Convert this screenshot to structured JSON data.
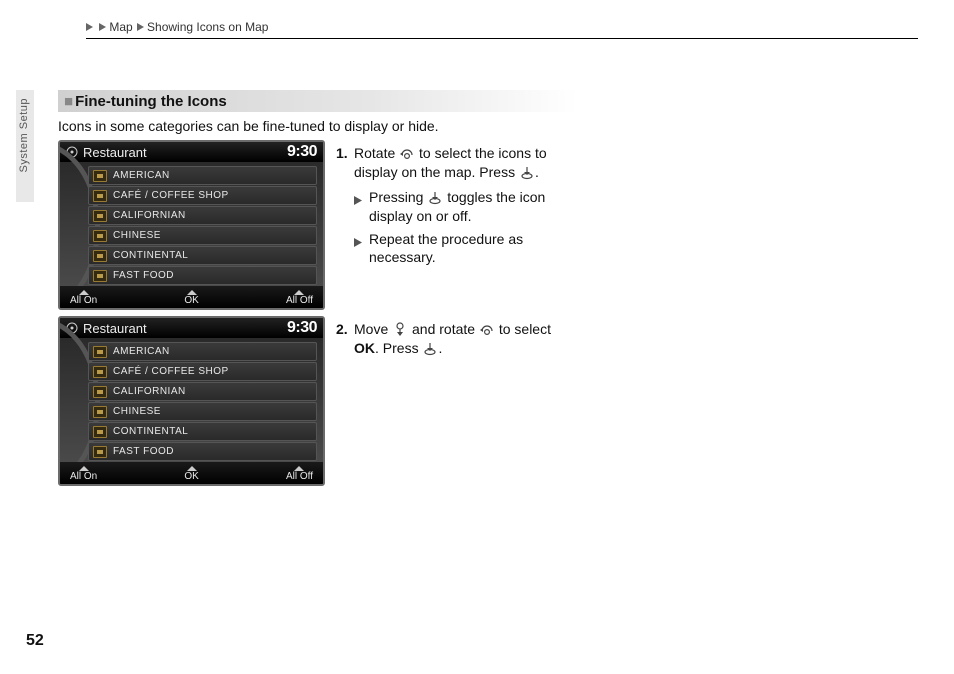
{
  "breadcrumb": {
    "part1": "Map",
    "part2": "Showing Icons on Map"
  },
  "side_tab": "System Setup",
  "section": {
    "title": "Fine-tuning the Icons"
  },
  "intro": "Icons in some categories can be fine-tuned to display or hide.",
  "screen": {
    "title": "Restaurant",
    "time": "9:30",
    "items": [
      "AMERICAN",
      "CAFÉ / COFFEE SHOP",
      "CALIFORNIAN",
      "CHINESE",
      "CONTINENTAL",
      "FAST FOOD"
    ],
    "footer": {
      "left": "All On",
      "mid": "OK",
      "right": "All Off"
    }
  },
  "steps": {
    "s1a": "Rotate ",
    "s1b": " to select the icons to display on the map. Press ",
    "s1c": ".",
    "s1sub1a": "Pressing ",
    "s1sub1b": " toggles the icon display on or off.",
    "s1sub2": "Repeat the procedure as necessary.",
    "s2a": "Move ",
    "s2b": " and rotate ",
    "s2c": " to select ",
    "s2d": "OK",
    "s2e": ". Press ",
    "s2f": "."
  },
  "page_number": "52"
}
